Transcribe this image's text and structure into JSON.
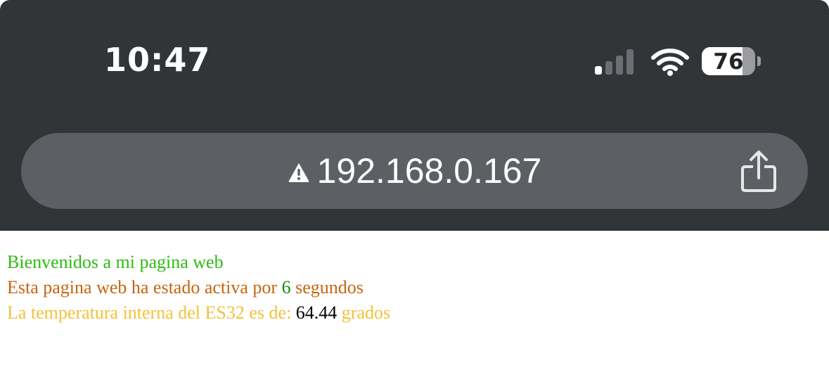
{
  "status_bar": {
    "time": "10:47",
    "battery_level": "76",
    "battery_fraction": 0.76,
    "signal_bars_active": 1,
    "signal_bars_total": 4
  },
  "browser": {
    "url": "192.168.0.167",
    "warning_icon": "warning-triangle-icon",
    "share_icon": "share-icon"
  },
  "page": {
    "welcome": "Bienvenidos a mi pagina web",
    "uptime_prefix": "Esta pagina web ha estado activa por",
    "uptime_value": "6",
    "uptime_suffix": "segundos",
    "temp_prefix": "La temperatura interna del ES32 es de:",
    "temp_value": "64.44",
    "temp_suffix": "grados"
  },
  "colors": {
    "chrome_bg": "#323538",
    "url_bar_bg": "#5c6064",
    "welcome": "#2dbd10",
    "uptime_text": "#c8640c",
    "uptime_value": "#188a18",
    "temp_text": "#f2c23a",
    "temp_value": "#000000"
  }
}
